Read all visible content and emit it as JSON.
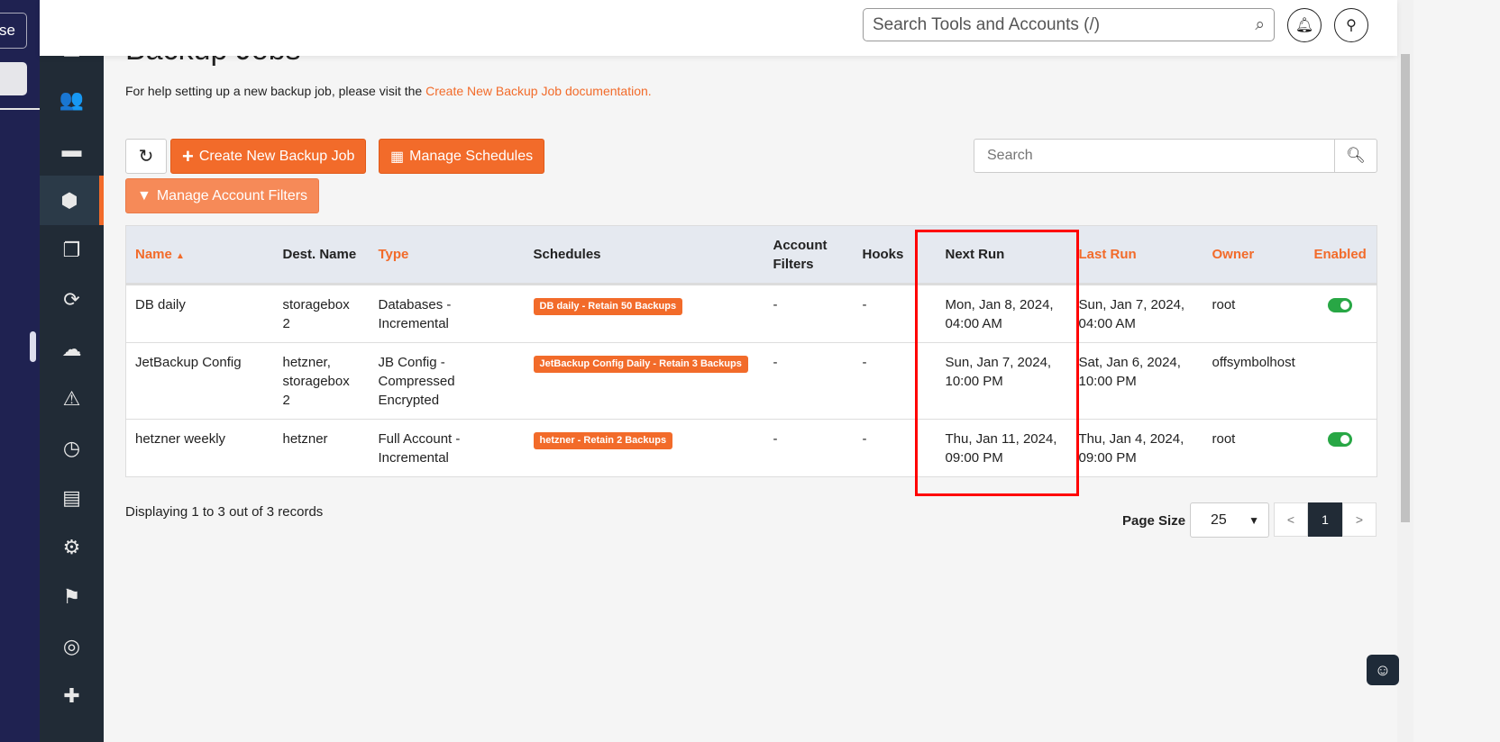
{
  "left_panel": {
    "button_fragment": "se"
  },
  "header": {
    "search_placeholder": "Search Tools and Accounts (/)"
  },
  "page": {
    "title": "Backup Jobs",
    "help_text": "For help setting up a new backup job, please visit the ",
    "help_link": "Create New Backup Job documentation."
  },
  "toolbar": {
    "create": "Create New Backup Job",
    "schedules": "Manage Schedules",
    "filters": "Manage Account Filters",
    "search_placeholder": "Search"
  },
  "table": {
    "headers": {
      "name": "Name",
      "dest": "Dest. Name",
      "type": "Type",
      "schedules": "Schedules",
      "filters": "Account Filters",
      "hooks": "Hooks",
      "next": "Next Run",
      "last": "Last Run",
      "owner": "Owner",
      "enabled": "Enabled"
    },
    "sort": {
      "column": "Name",
      "direction": "ascending"
    },
    "rows": [
      {
        "name": "DB daily",
        "dest": "storagebox 2",
        "type": "Databases - Incremental",
        "schedule": "DB daily - Retain 50 Backups",
        "filters": "-",
        "hooks": "-",
        "next": "Mon, Jan 8, 2024, 04:00 AM",
        "last": "Sun, Jan 7, 2024, 04:00 AM",
        "owner": "root",
        "enabled": true
      },
      {
        "name": "JetBackup Config",
        "dest": "hetzner, storagebox 2",
        "type": "JB Config - Compressed Encrypted",
        "schedule": "JetBackup Config Daily - Retain 3 Backups",
        "filters": "-",
        "hooks": "-",
        "next": "Sun, Jan 7, 2024, 10:00 PM",
        "last": "Sat, Jan 6, 2024, 10:00 PM",
        "owner": "offsymbolhost",
        "enabled": null
      },
      {
        "name": "hetzner weekly",
        "dest": "hetzner",
        "type": "Full Account - Incremental",
        "schedule": "hetzner - Retain 2 Backups",
        "filters": "-",
        "hooks": "-",
        "next": "Thu, Jan 11, 2024, 09:00 PM",
        "last": "Thu, Jan 4, 2024, 09:00 PM",
        "owner": "root",
        "enabled": true
      }
    ]
  },
  "footer": {
    "records": "Displaying 1 to 3 out of 3 records",
    "page_size_label": "Page Size",
    "page_size": "25",
    "prev": "<",
    "page": "1",
    "next": ">"
  },
  "colors": {
    "accent": "#f26b2a",
    "sidebar": "#212b36",
    "highlight": "#ff0000",
    "enabled": "#28a745"
  }
}
